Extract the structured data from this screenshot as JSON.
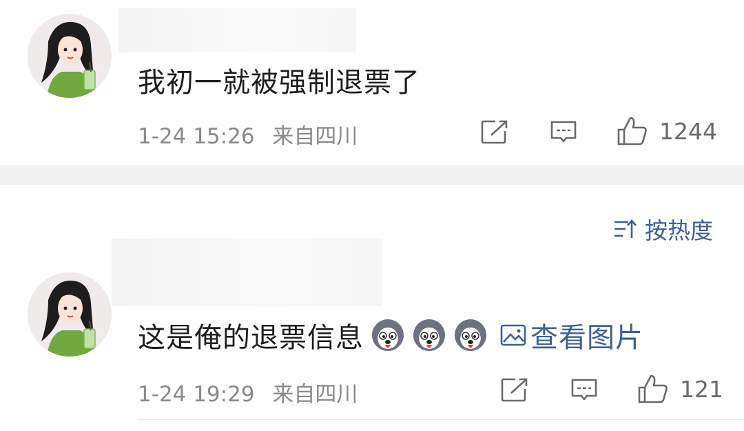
{
  "comments": [
    {
      "text": "我初一就被强制退票了",
      "date": "1-24 15:26",
      "location": "来自四川",
      "likes": "1244"
    },
    {
      "text": "这是俺的退票信息",
      "emoji_count": 3,
      "view_image_label": "查看图片",
      "date": "1-24 19:29",
      "location": "来自四川",
      "likes": "121"
    }
  ],
  "sort": {
    "label": "按热度"
  },
  "colors": {
    "link": "#3f6190",
    "meta": "#8a8a8a",
    "text": "#1e1e1e",
    "separator": "#f1f1f1"
  },
  "icons": [
    "share-icon",
    "reply-icon",
    "like-icon",
    "sort-icon",
    "image-icon",
    "husky-emoji"
  ]
}
